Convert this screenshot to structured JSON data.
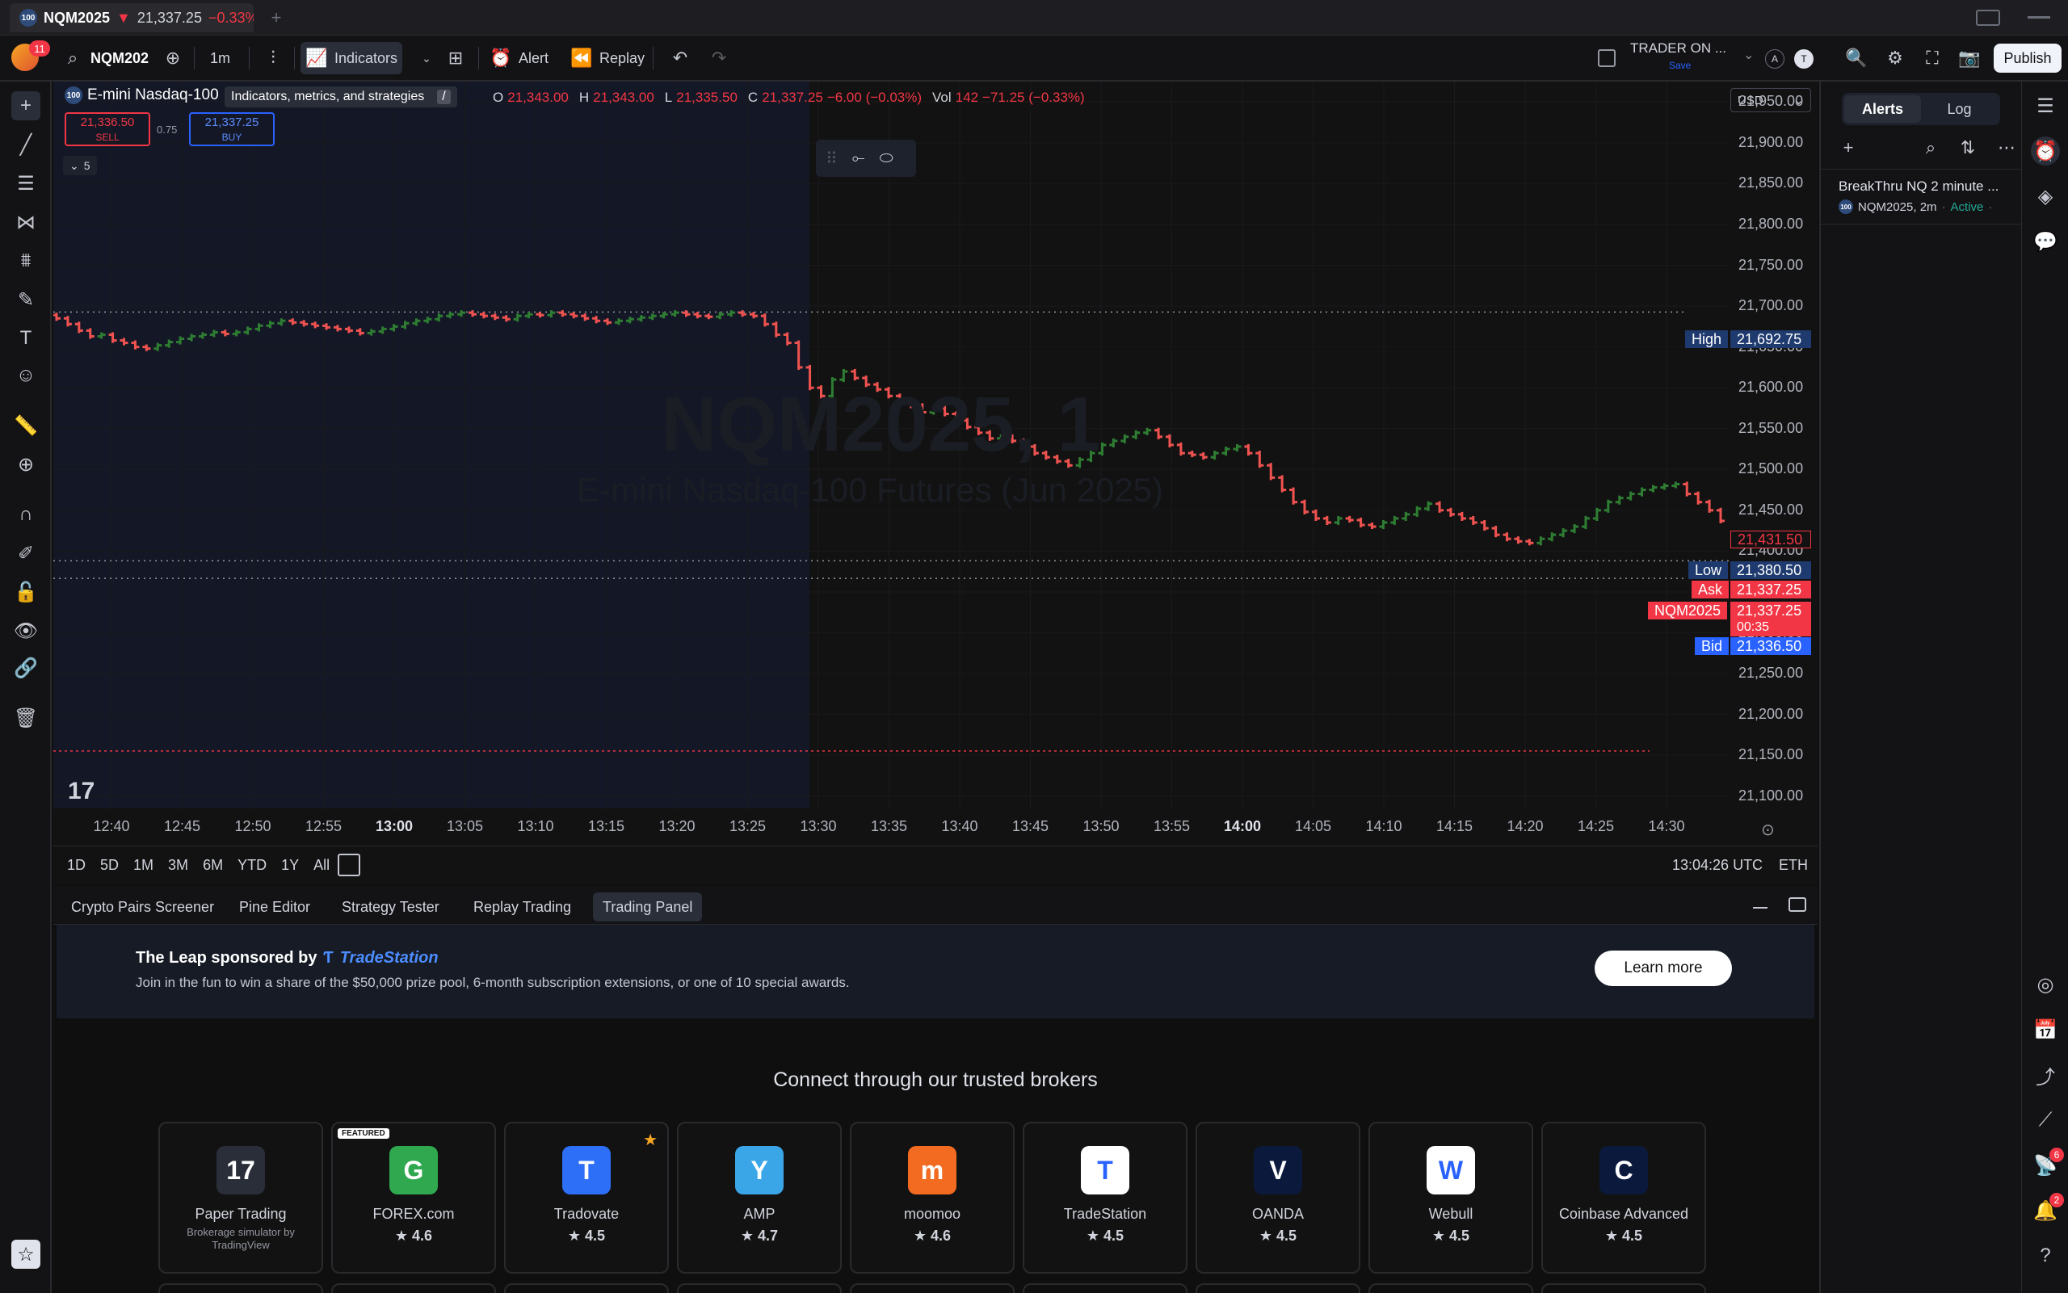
{
  "tab": {
    "symbol": "NQM2025",
    "arrow": "▼",
    "price": "21,337.25",
    "change": "−0.33%"
  },
  "toolbar": {
    "symbol": "NQM202",
    "interval": "1m",
    "indicators": "Indicators",
    "alert": "Alert",
    "replay": "Replay",
    "layout_name": "TRADER ON ...",
    "layout_save": "Save",
    "publish": "Publish",
    "avatar_a": "A",
    "avatar_t": "T",
    "notif_count": "11"
  },
  "tooltip": {
    "text": "Indicators, metrics, and strategies",
    "key": "/"
  },
  "legend": {
    "title": "E-mini Nasdaq-100",
    "o_label": "O",
    "o": "21,343.00",
    "h_label": "H",
    "h": "21,343.00",
    "l_label": "L",
    "l": "21,335.50",
    "c_label": "C",
    "c": "21,337.25",
    "chg": "−6.00 (−0.03%)",
    "vol_label": "Vol",
    "vol": "142",
    "vol_chg": "−71.25 (−0.33%)",
    "sell_price": "21,336.50",
    "sell": "SELL",
    "spread": "0.75",
    "buy_price": "21,337.25",
    "buy": "BUY",
    "collapse_count": "5"
  },
  "currency": "USD",
  "watermark": {
    "symbol": "NQM2025, 1",
    "name": "E-mini Nasdaq-100 Futures (Jun 2025)"
  },
  "price_axis": {
    "ticks": [
      "21,950.00",
      "21,900.00",
      "21,850.00",
      "21,800.00",
      "21,750.00",
      "21,700.00",
      "21,650.00",
      "21,600.00",
      "21,550.00",
      "21,500.00",
      "21,450.00",
      "21,400.00",
      "21,350.00",
      "21,300.00",
      "21,250.00",
      "21,200.00",
      "21,150.00",
      "21,100.00"
    ],
    "high_label": "High",
    "high": "21,692.75",
    "alert_price": "21,431.50",
    "low_label": "Low",
    "low": "21,380.50",
    "ask_label": "Ask",
    "ask": "21,337.25",
    "sym_label": "NQM2025",
    "last": "21,337.25",
    "countdown": "00:35",
    "bid_label": "Bid",
    "bid": "21,336.50"
  },
  "time_axis": {
    "ticks": [
      "12:40",
      "12:45",
      "12:50",
      "12:55",
      "13:00",
      "13:05",
      "13:10",
      "13:15",
      "13:20",
      "13:25",
      "13:30",
      "13:35",
      "13:40",
      "13:45",
      "13:50",
      "13:55",
      "14:00",
      "14:05",
      "14:10",
      "14:15",
      "14:20",
      "14:25",
      "14:30"
    ]
  },
  "ranges": [
    "1D",
    "5D",
    "1M",
    "3M",
    "6M",
    "YTD",
    "1Y",
    "All"
  ],
  "clock": "13:04:26 UTC",
  "session": "ETH",
  "bottom_tabs": [
    "Crypto Pairs Screener",
    "Pine Editor",
    "Strategy Tester",
    "Replay Trading",
    "Trading Panel"
  ],
  "banner": {
    "title": "The Leap sponsored by",
    "brand": "TradeStation",
    "text": "Join in the fun to win a share of the $50,000 prize pool, 6-month subscription extensions, or one of 10 special awards.",
    "cta": "Learn more"
  },
  "brokers_title": "Connect through our trusted brokers",
  "brokers": [
    {
      "name": "Paper Trading",
      "sub": "Brokerage simulator by TradingView",
      "rating": "",
      "color": "#2a2e39",
      "glyph": "17"
    },
    {
      "name": "FOREX.com",
      "rating": "4.6",
      "badge": "FEATURED",
      "color": "#2fa84f",
      "glyph": "G"
    },
    {
      "name": "Tradovate",
      "rating": "4.5",
      "color": "#2d6ff7",
      "glyph": "T",
      "star": true
    },
    {
      "name": "AMP",
      "rating": "4.7",
      "color": "#3aa6e8",
      "glyph": "Y"
    },
    {
      "name": "moomoo",
      "rating": "4.6",
      "color": "#f26b21",
      "glyph": "m"
    },
    {
      "name": "TradeStation",
      "rating": "4.5",
      "color": "#ffffff",
      "glyph": "T"
    },
    {
      "name": "OANDA",
      "rating": "4.5",
      "color": "#0b1a3c",
      "glyph": "V"
    },
    {
      "name": "Webull",
      "rating": "4.5",
      "color": "#ffffff",
      "glyph": "W"
    },
    {
      "name": "Coinbase Advanced",
      "rating": "4.5",
      "color": "#0b1a3c",
      "glyph": "C"
    }
  ],
  "alerts_panel": {
    "tab_alerts": "Alerts",
    "tab_log": "Log",
    "alert_name": "BreakThru NQ 2 minute ...",
    "alert_symbol": "NQM2025, 2m",
    "alert_status": "Active"
  },
  "right_badges": {
    "signal": "6",
    "bell": "2"
  },
  "colors": {
    "up": "#2e7d32",
    "down": "#ef5350",
    "bg": "#121212",
    "accent": "#2962ff"
  },
  "chart_data": {
    "type": "ohlc",
    "timeframe": "1m",
    "x_range": [
      "12:37",
      "14:35"
    ],
    "y_range": [
      21075,
      21975
    ],
    "closes": [
      21685,
      21678,
      21670,
      21663,
      21665,
      21658,
      21655,
      21650,
      21648,
      21652,
      21656,
      21660,
      21663,
      21665,
      21668,
      21666,
      21668,
      21672,
      21676,
      21679,
      21682,
      21680,
      21678,
      21676,
      21674,
      21672,
      21670,
      21667,
      21669,
      21672,
      21675,
      21679,
      21682,
      21684,
      21688,
      21690,
      21692,
      21690,
      21688,
      21686,
      21684,
      21688,
      21690,
      21689,
      21692,
      21690,
      21688,
      21685,
      21682,
      21680,
      21682,
      21684,
      21686,
      21688,
      21690,
      21692,
      21690,
      21688,
      21687,
      21690,
      21692,
      21690,
      21688,
      21678,
      21665,
      21655,
      21625,
      21600,
      21590,
      21610,
      21620,
      21612,
      21604,
      21598,
      21590,
      21585,
      21578,
      21570,
      21575,
      21568,
      21560,
      21552,
      21545,
      21538,
      21540,
      21535,
      21528,
      21520,
      21515,
      21510,
      21505,
      21512,
      21520,
      21530,
      21535,
      21540,
      21545,
      21548,
      21540,
      21530,
      21520,
      21518,
      21515,
      21520,
      21525,
      21528,
      21520,
      21505,
      21490,
      21475,
      21460,
      21448,
      21440,
      21435,
      21440,
      21438,
      21432,
      21430,
      21435,
      21440,
      21445,
      21452,
      21458,
      21450,
      21445,
      21440,
      21435,
      21428,
      21420,
      21415,
      21412,
      21410,
      21415,
      21420,
      21425,
      21430,
      21440,
      21450,
      21460,
      21465,
      21470,
      21475,
      21478,
      21480,
      21482,
      21470,
      21460,
      21450,
      21437
    ]
  }
}
